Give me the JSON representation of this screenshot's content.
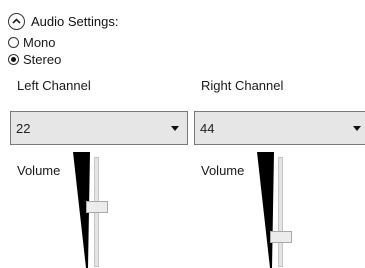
{
  "header": {
    "icon": "chevron-up-icon",
    "title": "Audio Settings:"
  },
  "mode": {
    "options": [
      {
        "label": "Mono",
        "checked": false
      },
      {
        "label": "Stereo",
        "checked": true
      }
    ]
  },
  "left": {
    "label": "Left Channel",
    "value": "22",
    "volume_label": "Volume",
    "volume_level": 0.55
  },
  "right": {
    "label": "Right Channel",
    "value": "44",
    "volume_label": "Volume",
    "volume_level": 0.25
  },
  "colors": {
    "combo_bg": "#e6e6e6",
    "wedge": "#000000"
  }
}
